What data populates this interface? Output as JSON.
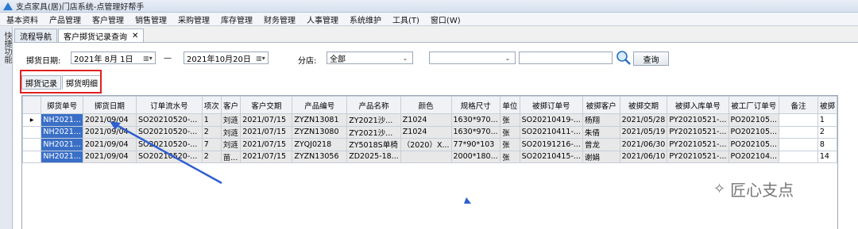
{
  "window": {
    "title": "支点家具(居)门店系统-点管理好帮手"
  },
  "menu": [
    "基本资料",
    "产品管理",
    "客户管理",
    "销售管理",
    "采购管理",
    "库存管理",
    "财务管理",
    "人事管理",
    "系统维护",
    "工具(T)",
    "窗口(W)"
  ],
  "sidebar": {
    "label": "快捷功能"
  },
  "tabs": [
    {
      "label": "流程导航"
    },
    {
      "label": "客户掷货记录查询",
      "close": "✕"
    }
  ],
  "filter": {
    "date_label": "掷货日期:",
    "date_from": "2021年 8月 1日",
    "date_sep": "—",
    "date_to": "2021年10月20日",
    "store_label": "分店:",
    "store_value": "全部",
    "query_label": "查询"
  },
  "subtabs": [
    "掷货记录",
    "掷货明细"
  ],
  "table": {
    "headers": [
      "掷货单号",
      "掷货日期",
      "订单流水号",
      "项次",
      "客户",
      "客户交期",
      "产品编号",
      "产品名称",
      "颜色",
      "规格尺寸",
      "单位",
      "被掷订单号",
      "被掷客户",
      "被掷交期",
      "被掷入库单号",
      "被工厂订单号",
      "备注",
      "被掷"
    ],
    "rows": [
      [
        "NH2021...",
        "2021/09/04",
        "SO20210520-...",
        "1",
        "刘涟",
        "2021/07/15",
        "ZYZN13081",
        "ZY2021沙...",
        "Z1024",
        "1630*970...",
        "张",
        "SO20210419-...",
        "杨翔",
        "2021/05/28",
        "PY20210521-...",
        "PO202105...",
        "",
        "1"
      ],
      [
        "NH2021...",
        "2021/09/04",
        "SO20210520-...",
        "2",
        "刘涟",
        "2021/07/15",
        "ZYZN13080",
        "ZY2021沙...",
        "Z1024",
        "1630*970...",
        "张",
        "SO20210411-...",
        "朱倩",
        "2021/05/19",
        "PY20210521-...",
        "PO202105...",
        "",
        "2"
      ],
      [
        "NH2021...",
        "2021/09/04",
        "SO20210520-...",
        "7",
        "刘涟",
        "2021/07/15",
        "ZYQJ0218",
        "ZY5018S单椅",
        "（2020）X...",
        "77*90*103",
        "张",
        "SO20191216-...",
        "曾龙",
        "2021/06/30",
        "PY20210521-...",
        "PO202105...",
        "",
        "8"
      ],
      [
        "NH2021...",
        "2021/09/04",
        "SO20210520-...",
        "2",
        "苗...",
        "2021/07/15",
        "ZYZN13056",
        "ZD2025-18...",
        "",
        "2000*180...",
        "张",
        "SO20210415-...",
        "谢娟",
        "2021/06/10",
        "PY20210521-...",
        "PO202104...",
        "",
        "14"
      ]
    ]
  },
  "watermark": {
    "text": "匠心支点"
  },
  "colors": {
    "selected_cell": "#3a6fc7",
    "highlight_box": "#e02020",
    "arrow": "#2f5fcf"
  }
}
